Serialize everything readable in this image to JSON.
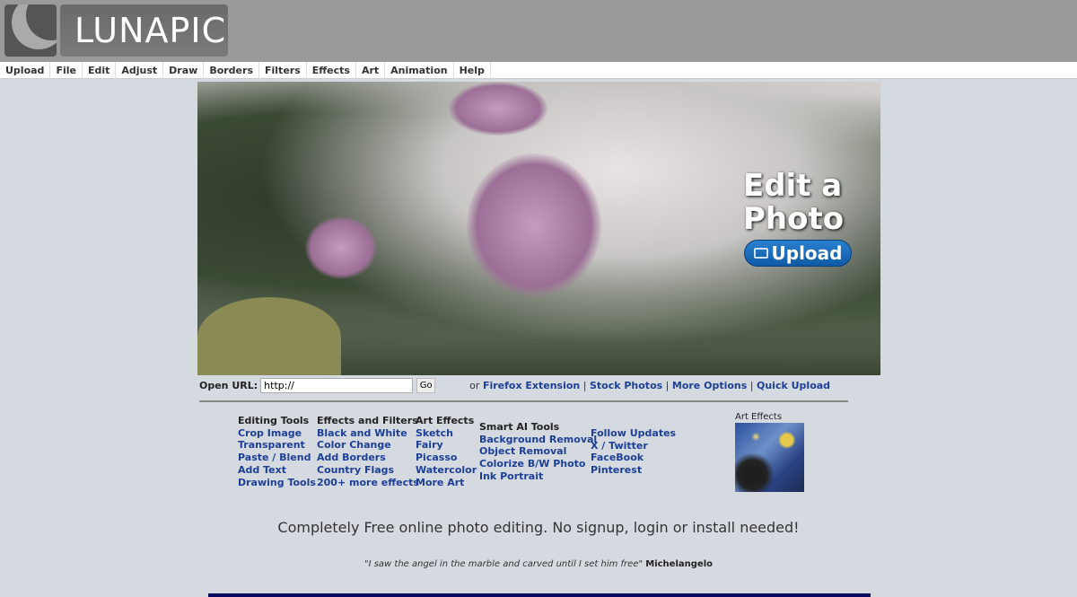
{
  "logo": {
    "text": "LUNAPIC"
  },
  "menu": [
    "Upload",
    "File",
    "Edit",
    "Adjust",
    "Draw",
    "Borders",
    "Filters",
    "Effects",
    "Art",
    "Animation",
    "Help"
  ],
  "hero": {
    "title_line1": "Edit a",
    "title_line2": "Photo",
    "upload_label": "Upload"
  },
  "url_row": {
    "label": "Open URL:",
    "value": "http://",
    "go_label": "Go",
    "or": "or",
    "links": [
      "Firefox Extension",
      "Stock Photos",
      "More Options",
      "Quick Upload"
    ]
  },
  "columns": [
    {
      "heading": "Editing Tools",
      "items": [
        "Crop Image",
        "Transparent",
        "Paste / Blend",
        "Add Text",
        "Drawing Tools"
      ]
    },
    {
      "heading": "Effects and Filters",
      "items": [
        "Black and White",
        "Color Change",
        "Add Borders",
        "Country Flags",
        "200+ more effects"
      ]
    },
    {
      "heading": "Art Effects",
      "items": [
        "Sketch",
        "Fairy",
        "Picasso",
        "Watercolor",
        "More Art"
      ]
    },
    {
      "heading": "Smart AI Tools",
      "items": [
        "Background Removal",
        "Object Removal",
        "Colorize B/W Photo",
        "Ink Portrait"
      ]
    },
    {
      "heading": "",
      "items": [
        "Follow Updates",
        "X / Twitter",
        "FaceBook",
        "Pinterest"
      ]
    }
  ],
  "art_effects_thumb": {
    "label": "Art Effects"
  },
  "tagline": "Completely Free online photo editing. No signup, login or install needed!",
  "quote": {
    "text": "\"I saw the angel in the marble and carved until I set him free\"",
    "author": "Michelangelo"
  }
}
